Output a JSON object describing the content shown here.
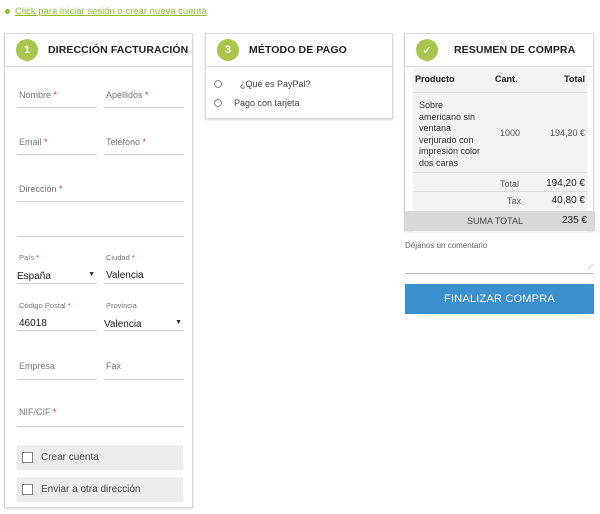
{
  "login_link": "Click para iniciar sesión o crear nueva cuenta",
  "billing": {
    "step": "1",
    "title": "DIRECCIÓN FACTURACIÓN",
    "fields": {
      "nombre": {
        "label": "Nombre",
        "required": "*",
        "value": ""
      },
      "apellidos": {
        "label": "Apellidos",
        "required": "*",
        "value": ""
      },
      "email": {
        "label": "Email",
        "required": "*",
        "value": ""
      },
      "telefono": {
        "label": "Teléfono",
        "required": "*",
        "value": ""
      },
      "direccion": {
        "label": "Dirección",
        "required": "*",
        "value": ""
      },
      "pais": {
        "label": "País",
        "required": "*",
        "value": "España"
      },
      "ciudad": {
        "label": "Ciudad",
        "required": "*",
        "value": "Valencia"
      },
      "codigo_postal": {
        "label": "Código Postal",
        "required": "*",
        "value": "46018"
      },
      "provincia": {
        "label": "Provincia",
        "required": "",
        "value": "Valencia"
      },
      "empresa": {
        "label": "Empresa",
        "value": ""
      },
      "fax": {
        "label": "Fax",
        "value": ""
      },
      "nif": {
        "label": "NIF/CIF",
        "required": "*",
        "value": ""
      }
    },
    "create_account": "Crear cuenta",
    "ship_other": "Enviar a otra dirección"
  },
  "payment": {
    "step": "3",
    "title": "MÉTODO DE PAGO",
    "options": [
      "¿Qué es PayPal?",
      "Pago con tarjeta"
    ]
  },
  "summary": {
    "step": "✓",
    "title": "RESUMEN DE COMPRA",
    "headers": {
      "product": "Producto",
      "qty": "Cant.",
      "total": "Total"
    },
    "item": {
      "name": "Sobre americano sin ventana verjurado con impresión color dos caras",
      "qty": "1000",
      "total": "194,20 €"
    },
    "total_label": "Total",
    "total_value": "194,20 €",
    "tax_label": "Tax",
    "tax_value": "40,80 €",
    "sum_label": "SUMA TOTAL",
    "sum_value": "235 €"
  },
  "comment": {
    "label": "Déjanos un comentario",
    "value": ""
  },
  "finish_button": "FINALIZAR COMPRA",
  "colors": {
    "accent_green": "#a7c64b",
    "link_green": "#8dbb2c",
    "button_blue": "#3a8fcf",
    "required_red": "#d9342b"
  }
}
